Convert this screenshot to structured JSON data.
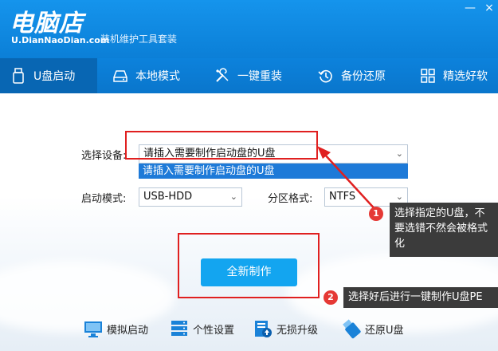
{
  "app": {
    "logo_main": "电脑店",
    "logo_url": "U.DianNaoDian.com",
    "logo_subtitle": "装机维护工具套装",
    "win_minimize": "—",
    "win_close": "×"
  },
  "tabs": [
    {
      "label": "U盘启动",
      "icon": "usb-drive-icon",
      "active": true
    },
    {
      "label": "本地模式",
      "icon": "hard-disk-icon",
      "active": false
    },
    {
      "label": "一键重装",
      "icon": "tools-icon",
      "active": false
    },
    {
      "label": "备份还原",
      "icon": "restore-clock-icon",
      "active": false
    },
    {
      "label": "精选好软",
      "icon": "grid-apps-icon",
      "active": false
    }
  ],
  "form": {
    "device_label": "选择设备:",
    "device_value": "请插入需要制作启动盘的U盘",
    "device_option": "请插入需要制作启动盘的U盘",
    "boot_label": "启动模式:",
    "boot_value": "USB-HDD",
    "format_label": "分区格式:",
    "format_value": "NTFS"
  },
  "make_button": "全新制作",
  "callouts": [
    {
      "badge": "1",
      "text": "选择指定的U盘，不要选错不然会被格式化"
    },
    {
      "badge": "2",
      "text": "选择好后进行一键制作U盘PE"
    }
  ],
  "bottom_tools": [
    {
      "label": "模拟启动",
      "icon": "monitor-icon"
    },
    {
      "label": "个性设置",
      "icon": "server-settings-icon"
    },
    {
      "label": "无损升级",
      "icon": "upgrade-icon"
    },
    {
      "label": "还原U盘",
      "icon": "usb-restore-icon"
    }
  ],
  "colors": {
    "header_blue": "#0b7fd7",
    "active_tab": "#0866b3",
    "button_blue": "#13a5f0",
    "highlight_red": "#e02020",
    "callout_bg": "#3b3b3b",
    "badge_red": "#e53935"
  }
}
